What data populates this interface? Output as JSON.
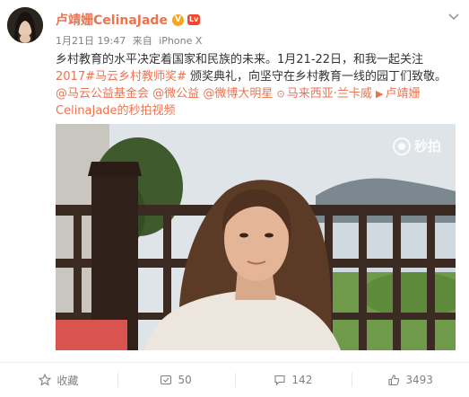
{
  "post": {
    "username": "卢靖姗CelinaJade",
    "verified_badge": "V",
    "level_badge": "Lv",
    "timestamp": "1月21日 19:47",
    "source_prefix": "来自",
    "source": "iPhone X",
    "text_part1": "乡村教育的水平决定着国家和民族的未来。1月21-22日，和我一起关注",
    "link_award": "2017#马云乡村教师奖#",
    "text_part2": " 颁奖典礼，向坚守在乡村教育一线的园丁们致敬。",
    "mention_1": "@马云公益基金会",
    "mention_2": "@微公益",
    "mention_3": "@微博大明星",
    "location": "马来西亚·兰卡威",
    "video_link": "卢靖姗CelinaJade的秒拍视频"
  },
  "video": {
    "watermark": "秒拍"
  },
  "actions": {
    "favorite_label": "收藏",
    "repost_count": "50",
    "comment_count": "142",
    "like_count": "3493"
  },
  "icons": {
    "avatar": "avatar",
    "menu": "chevron-down-icon",
    "location": "location-pin-icon",
    "video": "video-camera-icon",
    "favorite": "star-icon",
    "repost": "repost-icon",
    "comment": "comment-icon",
    "like": "thumbs-up-icon"
  },
  "colors": {
    "accent": "#eb7350",
    "meta_gray": "#808080",
    "text": "#333333"
  }
}
